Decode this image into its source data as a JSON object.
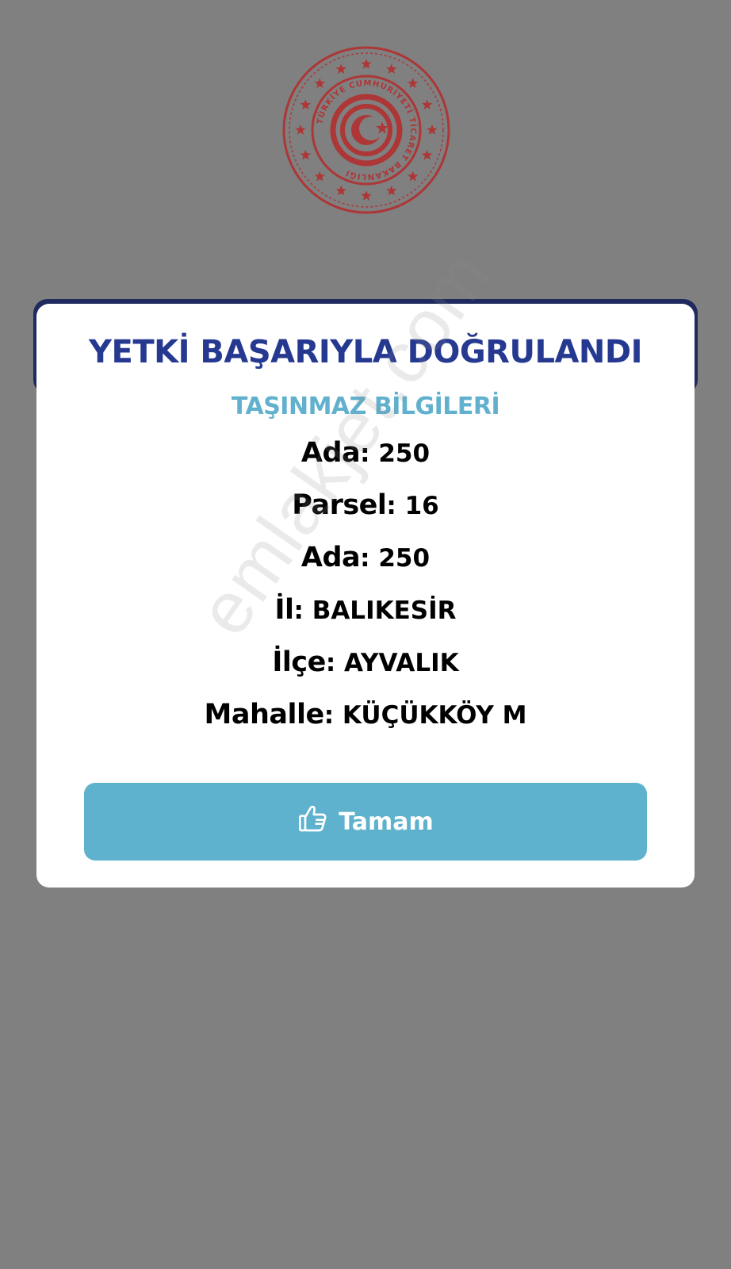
{
  "seal": {
    "text": "TÜRKİYE CUMHURİYETİ TİCARET BAKANLIĞI",
    "icon": "ministry-seal-icon",
    "color": "#b52a2a"
  },
  "dialog": {
    "title": "YETKİ BAŞARIYLA DOĞRULANDI",
    "subtitle": "TAŞINMAZ BİLGİLERİ",
    "rows": [
      {
        "label": "Ada",
        "value": ": 250"
      },
      {
        "label": "Parsel",
        "value": ": 16"
      },
      {
        "label": "Ada",
        "value": ": 250"
      },
      {
        "label": "İl",
        "value": ": BALIKESİR"
      },
      {
        "label": "İlçe",
        "value": ": AYVALIK"
      },
      {
        "label": "Mahalle",
        "value": ": KÜÇÜKKÖY M"
      }
    ],
    "button": {
      "label": "Tamam",
      "icon": "thumbs-up-icon"
    }
  },
  "watermark": "emlakjet.com",
  "colors": {
    "background": "#808080",
    "title": "#263990",
    "subtitle": "#61b1ce",
    "button": "#5eb2cd"
  }
}
